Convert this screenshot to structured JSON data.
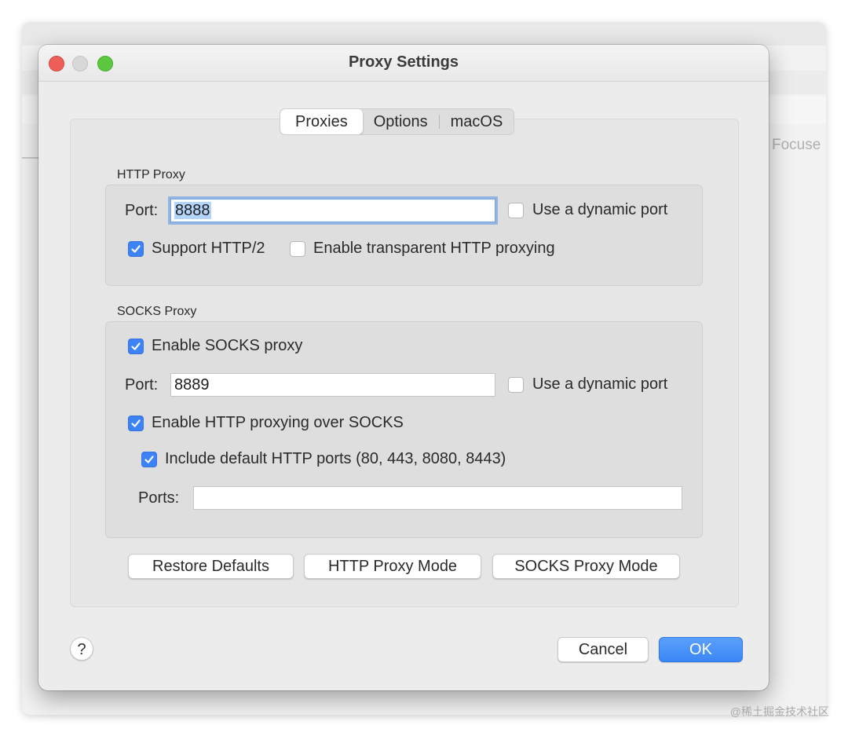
{
  "dialog": {
    "title": "Proxy Settings"
  },
  "background": {
    "partial_text": "Focuse"
  },
  "tabs": [
    {
      "label": "Proxies",
      "active": true
    },
    {
      "label": "Options",
      "active": false
    },
    {
      "label": "macOS",
      "active": false
    }
  ],
  "http_proxy": {
    "section_label": "HTTP Proxy",
    "port_label": "Port:",
    "port_value": "8888",
    "dynamic_port_label": "Use a dynamic port",
    "dynamic_port_checked": false,
    "http2_label": "Support HTTP/2",
    "http2_checked": true,
    "transparent_label": "Enable transparent HTTP proxying",
    "transparent_checked": false
  },
  "socks_proxy": {
    "section_label": "SOCKS Proxy",
    "enable_label": "Enable SOCKS proxy",
    "enable_checked": true,
    "port_label": "Port:",
    "port_value": "8889",
    "dynamic_port_label": "Use a dynamic port",
    "dynamic_port_checked": false,
    "http_over_socks_label": "Enable HTTP proxying over SOCKS",
    "http_over_socks_checked": true,
    "default_ports_label": "Include default HTTP ports (80, 443, 8080, 8443)",
    "default_ports_checked": true,
    "ports_label": "Ports:",
    "ports_value": ""
  },
  "actions": {
    "restore_defaults": "Restore Defaults",
    "http_proxy_mode": "HTTP Proxy Mode",
    "socks_proxy_mode": "SOCKS Proxy Mode",
    "cancel": "Cancel",
    "ok": "OK",
    "help": "?"
  },
  "watermark": "@稀土掘金技术社区",
  "colors": {
    "accent": "#3d82f7",
    "close": "#ed5f58",
    "maximize": "#5cc73f"
  }
}
